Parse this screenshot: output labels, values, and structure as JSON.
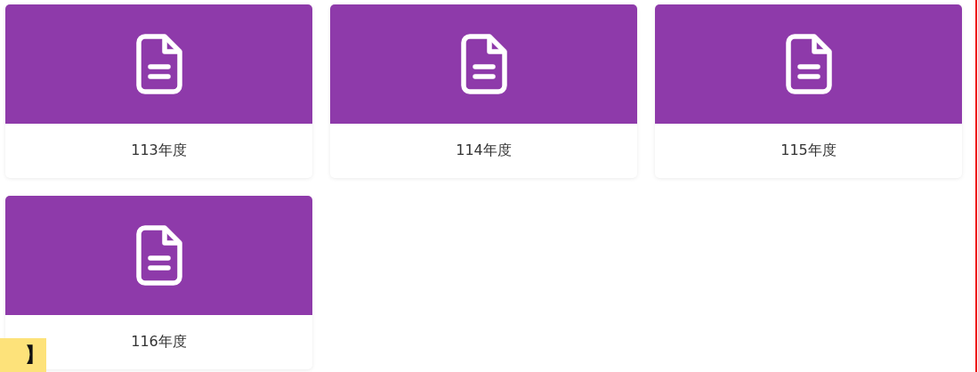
{
  "cards": [
    {
      "label": "113年度"
    },
    {
      "label": "114年度"
    },
    {
      "label": "115年度"
    },
    {
      "label": "116年度"
    }
  ],
  "corner_tag": {
    "text": "】"
  }
}
